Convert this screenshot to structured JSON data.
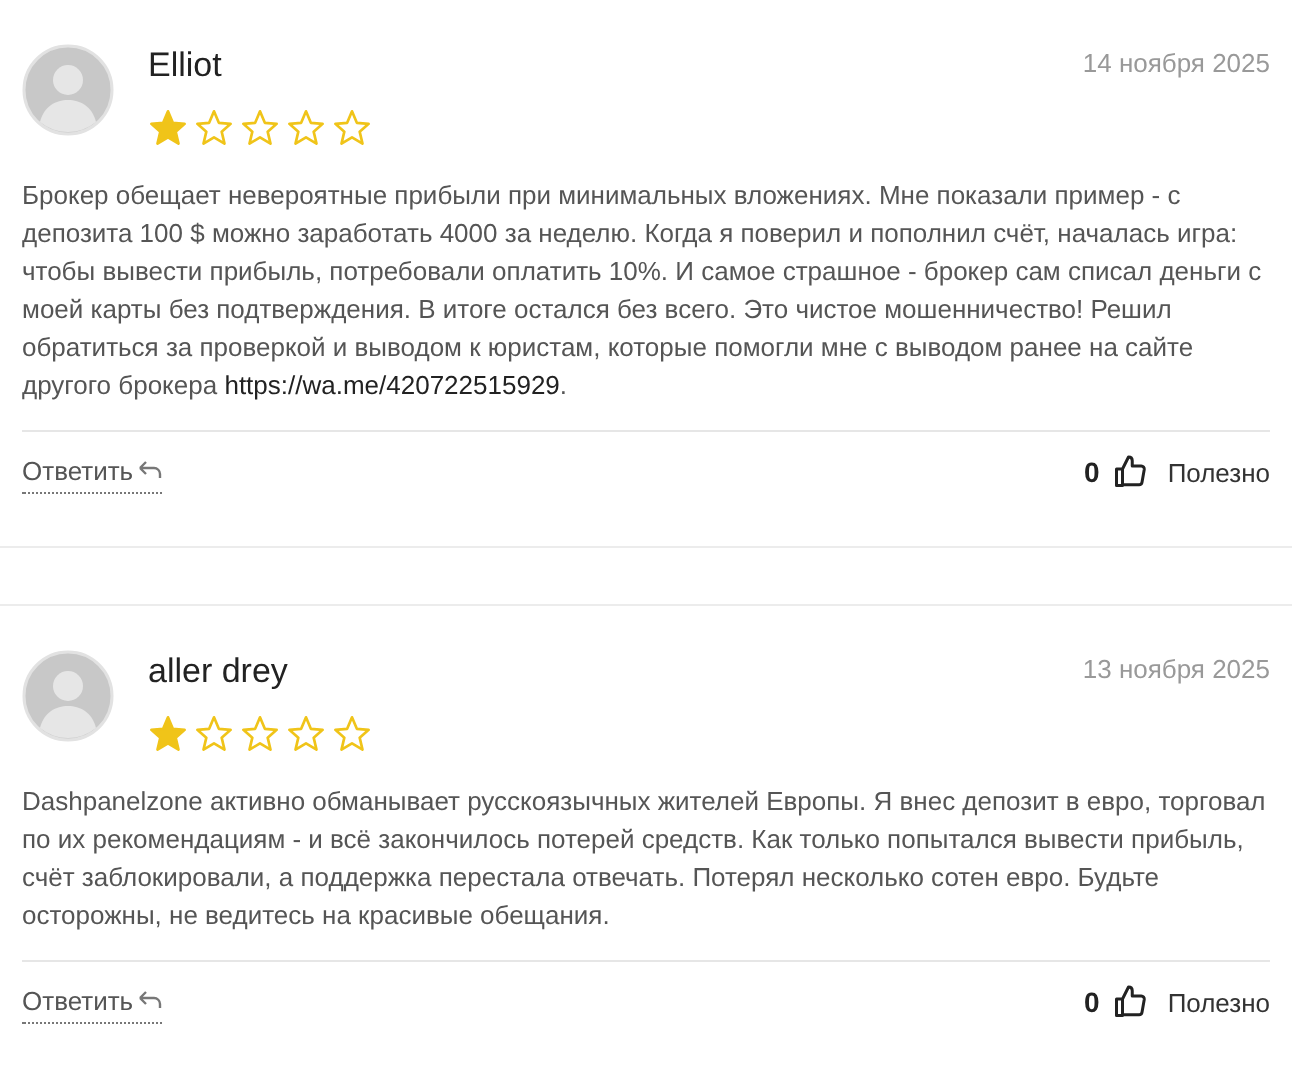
{
  "reviews": [
    {
      "author": "Elliot",
      "date": "14 ноября 2025",
      "stars": 1,
      "text": "Брокер обещает невероятные прибыли при минимальных вложениях. Мне показали пример - с депозита 100 $ можно заработать 4000 за неделю. Когда я поверил и пополнил счёт, началась игра: чтобы вывести прибыль, потребовали оплатить 10%. И самое страшное - брокер сам списал деньги с моей карты без подтверждения. В итоге остался без всего. Это чистое мошенничество! Решил обратиться за проверкой и выводом к юристам, которые помогли мне с выводом ранее на сайте другого брокера",
      "link": "https://wa.me/420722515929",
      "after_link": ".",
      "reply": "Ответить",
      "likes": "0",
      "helpful": "Полезно"
    },
    {
      "author": "aller drey",
      "date": "13 ноября 2025",
      "stars": 1,
      "text": "Dashpanelzone активно обманывает русскоязычных жителей Европы. Я внес депозит в евро, торговал по их рекомендациям - и всё закончилось потерей средств. Как только попытался вывести прибыль, счёт заблокировали, а поддержка перестала отвечать. Потерял несколько сотен евро. Будьте осторожны, не ведитесь на красивые обещания.",
      "reply": "Ответить",
      "likes": "0",
      "helpful": "Полезно"
    }
  ]
}
